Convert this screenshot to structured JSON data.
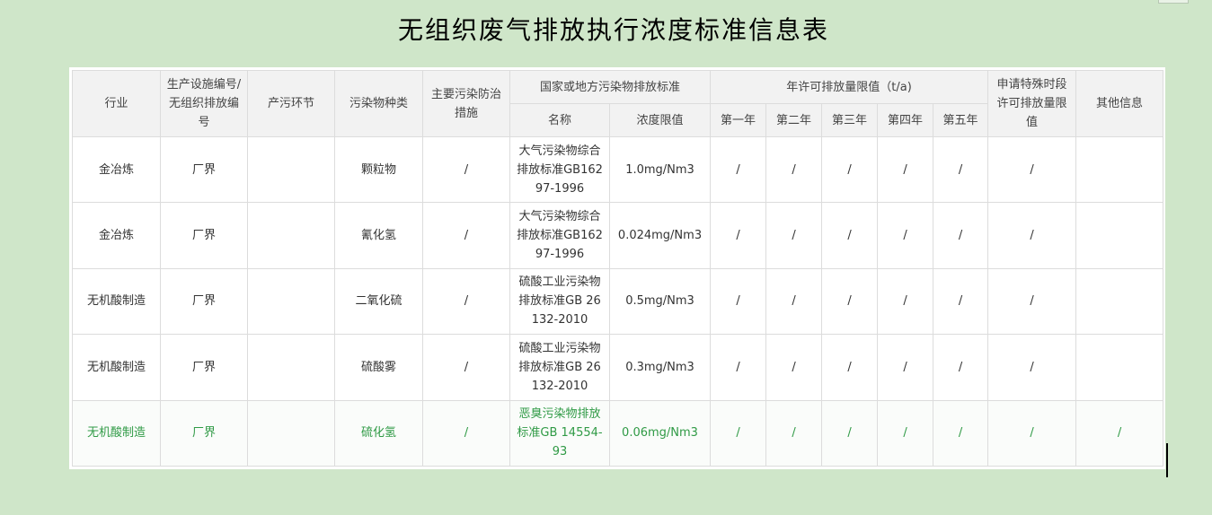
{
  "title": "无组织废气排放执行浓度标准信息表",
  "headers": {
    "industry": "行业",
    "facility_code": "生产设施编号/无组织排放编号",
    "pollution_stage": "产污环节",
    "pollutant_type": "污染物种类",
    "control_measures": "主要污染防治措施",
    "standard_group": "国家或地方污染物排放标准",
    "standard_name": "名称",
    "concentration_limit": "浓度限值",
    "annual_group": "年许可排放量限值（t/a)",
    "year1": "第一年",
    "year2": "第二年",
    "year3": "第三年",
    "year4": "第四年",
    "year5": "第五年",
    "special_period": "申请特殊时段许可排放量限值",
    "other_info": "其他信息"
  },
  "rows": [
    {
      "industry": "金冶炼",
      "facility": "厂界",
      "stage": "",
      "pollutant": "颗粒物",
      "measures": "/",
      "standard": "大气污染物综合排放标准GB16297-1996",
      "limit": "1.0mg/Nm3",
      "y1": "/",
      "y2": "/",
      "y3": "/",
      "y4": "/",
      "y5": "/",
      "special": "/",
      "other": ""
    },
    {
      "industry": "金冶炼",
      "facility": "厂界",
      "stage": "",
      "pollutant": "氰化氢",
      "measures": "/",
      "standard": "大气污染物综合排放标准GB16297-1996",
      "limit": "0.024mg/Nm3",
      "y1": "/",
      "y2": "/",
      "y3": "/",
      "y4": "/",
      "y5": "/",
      "special": "/",
      "other": ""
    },
    {
      "industry": "无机酸制造",
      "facility": "厂界",
      "stage": "",
      "pollutant": "二氧化硫",
      "measures": "/",
      "standard": "硫酸工业污染物排放标准GB 26132-2010",
      "limit": "0.5mg/Nm3",
      "y1": "/",
      "y2": "/",
      "y3": "/",
      "y4": "/",
      "y5": "/",
      "special": "/",
      "other": ""
    },
    {
      "industry": "无机酸制造",
      "facility": "厂界",
      "stage": "",
      "pollutant": "硫酸雾",
      "measures": "/",
      "standard": "硫酸工业污染物排放标准GB 26132-2010",
      "limit": "0.3mg/Nm3",
      "y1": "/",
      "y2": "/",
      "y3": "/",
      "y4": "/",
      "y5": "/",
      "special": "/",
      "other": ""
    },
    {
      "industry": "无机酸制造",
      "facility": "厂界",
      "stage": "",
      "pollutant": "硫化氢",
      "measures": "/",
      "standard": "恶臭污染物排放标准GB 14554-93",
      "limit": "0.06mg/Nm3",
      "y1": "/",
      "y2": "/",
      "y3": "/",
      "y4": "/",
      "y5": "/",
      "special": "/",
      "other": "/"
    }
  ],
  "colors": {
    "background": "#cfe6c9",
    "header_bg": "#f2f2f2",
    "highlight_text": "#2f9a45"
  }
}
